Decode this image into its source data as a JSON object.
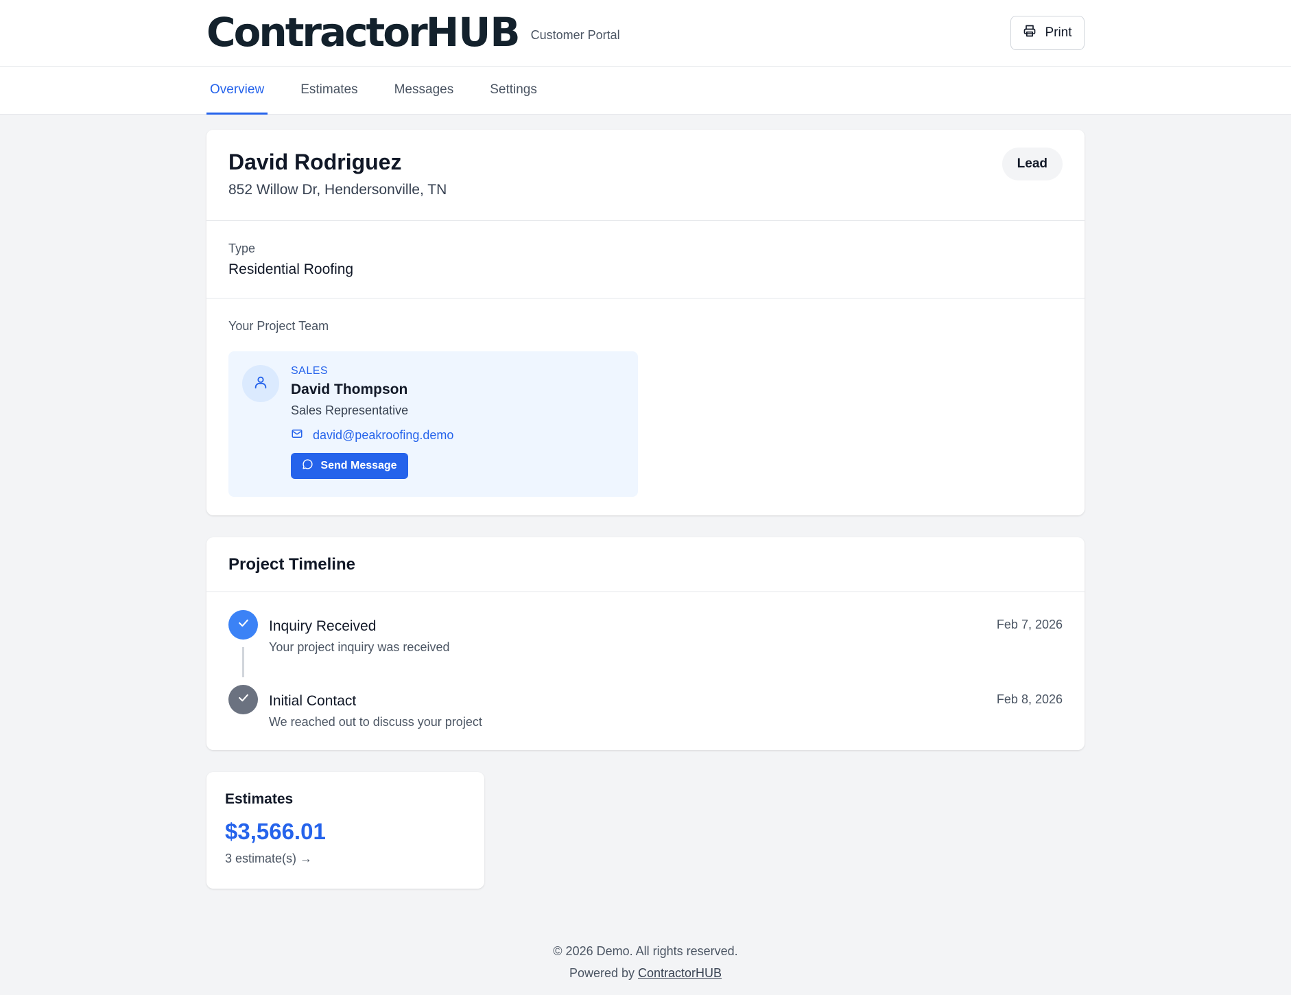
{
  "header": {
    "logo_main": "Contractor",
    "logo_hub": "HUB",
    "portal_label": "Customer Portal",
    "print_label": "Print"
  },
  "tabs": [
    {
      "label": "Overview",
      "active": true
    },
    {
      "label": "Estimates",
      "active": false
    },
    {
      "label": "Messages",
      "active": false
    },
    {
      "label": "Settings",
      "active": false
    }
  ],
  "customer": {
    "name": "David Rodriguez",
    "address": "852 Willow Dr, Hendersonville, TN",
    "status": "Lead",
    "type_label": "Type",
    "type_value": "Residential Roofing"
  },
  "team": {
    "heading": "Your Project Team",
    "member": {
      "role": "SALES",
      "name": "David Thompson",
      "title": "Sales Representative",
      "email": "david@peakroofing.demo",
      "button_label": "Send Message"
    }
  },
  "timeline": {
    "title": "Project Timeline",
    "items": [
      {
        "event": "Inquiry Received",
        "description": "Your project inquiry was received",
        "date": "Feb 7, 2026",
        "dot_color": "#3b82f6"
      },
      {
        "event": "Initial Contact",
        "description": "We reached out to discuss your project",
        "date": "Feb 8, 2026",
        "dot_color": "#6b7280"
      }
    ]
  },
  "estimates": {
    "title": "Estimates",
    "total": "$3,566.01",
    "count_label": "3 estimate(s) →"
  },
  "footer": {
    "copyright": "© 2026 Demo. All rights reserved.",
    "powered_prefix": "Powered by",
    "powered_link": "ContractorHUB"
  },
  "colors": {
    "accent": "#2563eb",
    "background": "#f3f4f6",
    "team_card_bg": "#eff6ff"
  }
}
